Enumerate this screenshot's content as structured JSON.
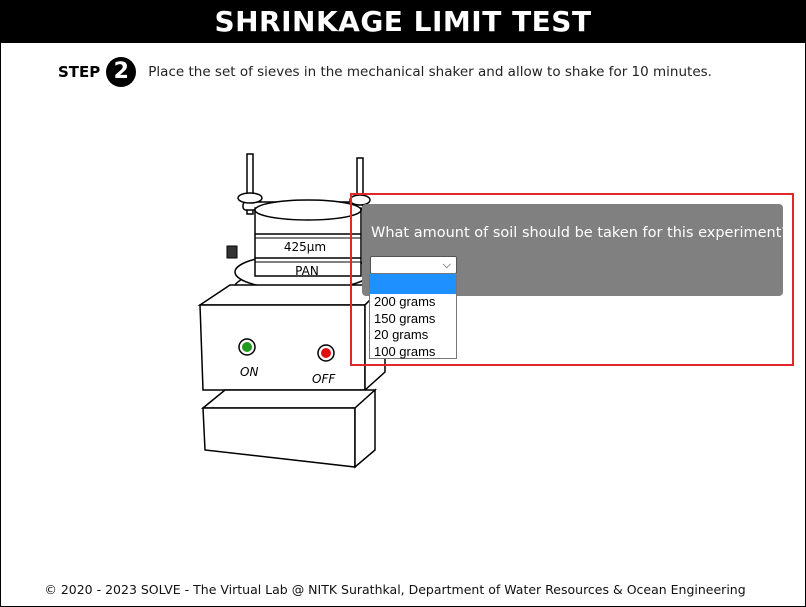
{
  "header": {
    "title": "SHRINKAGE LIMIT TEST"
  },
  "step": {
    "label": "STEP",
    "number": "2",
    "instruction": "Place the set of sieves in the mechanical shaker and allow to shake for 10 minutes."
  },
  "apparatus": {
    "sieve_label": "425µm",
    "pan_label": "PAN",
    "on_label": "ON",
    "off_label": "OFF",
    "on_color": "#1f9a1f",
    "off_color": "#e01010"
  },
  "question": {
    "text": "What amount of soil should be taken for this experiment?",
    "selected_value": "",
    "options": [
      "",
      "200 grams",
      "150 grams",
      "20 grams",
      "100 grams"
    ]
  },
  "footer": {
    "text": "© 2020 - 2023 SOLVE - The Virtual Lab @ NITK Surathkal, Department of Water Resources & Ocean Engineering"
  },
  "colors": {
    "highlight": "#e02828",
    "question_bg": "#808080",
    "option_highlight": "#1e90ff"
  }
}
